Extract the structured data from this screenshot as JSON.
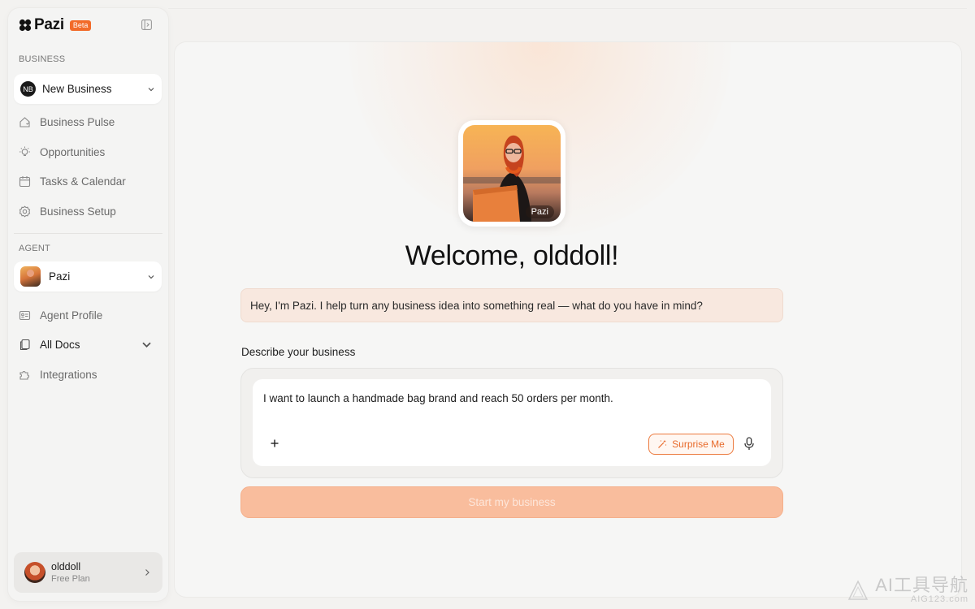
{
  "sidebar": {
    "brand": "Pazi",
    "beta_label": "Beta",
    "business_section_label": "BUSINESS",
    "business_select": {
      "initials": "NB",
      "label": "New Business"
    },
    "business_nav": [
      {
        "label": "Business Pulse",
        "icon": "home-icon"
      },
      {
        "label": "Opportunities",
        "icon": "lightbulb-icon"
      },
      {
        "label": "Tasks & Calendar",
        "icon": "calendar-icon"
      },
      {
        "label": "Business Setup",
        "icon": "gear-icon"
      }
    ],
    "agent_section_label": "AGENT",
    "agent_select": {
      "label": "Pazi"
    },
    "agent_nav": [
      {
        "label": "Agent Profile",
        "icon": "id-card-icon"
      },
      {
        "label": "All Docs",
        "icon": "docs-icon"
      },
      {
        "label": "Integrations",
        "icon": "puzzle-icon"
      }
    ],
    "user": {
      "name": "olddoll",
      "plan": "Free Plan"
    }
  },
  "main": {
    "agent_photo_tag": "Pazi",
    "welcome": "Welcome, olddoll!",
    "greeting": "Hey, I'm Pazi. I help turn any business idea into something real — what do you have in mind?",
    "describe_label": "Describe your business",
    "composer_text": "I want to launch a handmade bag brand and reach 50 orders per month.",
    "plus_label": "+",
    "surprise_label": "Surprise Me",
    "start_label": "Start my business"
  },
  "watermark": {
    "main": "AI工具导航",
    "sub": "AIG123.com"
  },
  "colors": {
    "accent": "#f26b2a",
    "start_button": "#f9bd9d",
    "greeting_bg": "#f8e8df"
  }
}
